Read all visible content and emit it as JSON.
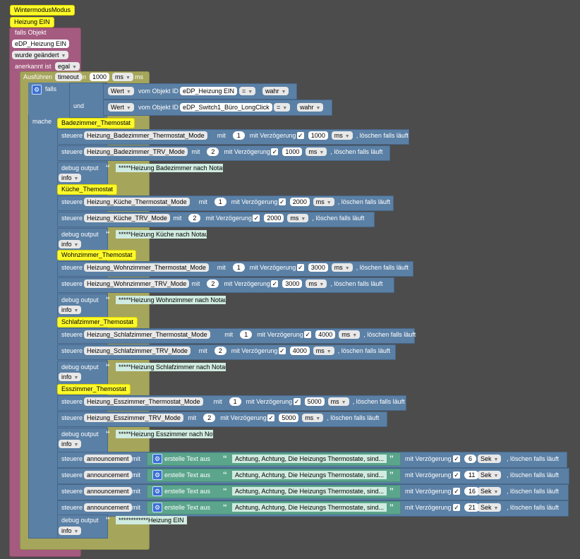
{
  "comments": {
    "title": "WintermodusModus",
    "subtitle": "Heizung EIN"
  },
  "trigger": {
    "falls_objekt": "falls Objekt",
    "object_id": "eDP_Heizung EIN",
    "wurde_label": "wurde geändert",
    "anerkannt_label": "anerkannt ist",
    "anerkannt_value": "egal"
  },
  "timeout": {
    "ausfuehren": "Ausführen",
    "var": "timeout",
    "in": "in",
    "value": "1000",
    "unit": "ms",
    "unit_suffix": "ms"
  },
  "if_block": {
    "falls": "falls",
    "und": "und",
    "mache": "mache",
    "cond1": {
      "wert": "Wert",
      "vom_objekt": "vom Objekt ID",
      "object": "eDP_Heizung EIN",
      "op": "=",
      "value": "wahr"
    },
    "cond2": {
      "wert": "Wert",
      "vom_objekt": "vom Objekt ID",
      "object": "eDP_Switch1_Büro_LongClick",
      "op": "=",
      "value": "wahr"
    }
  },
  "labels": {
    "steuere": "steuere",
    "mit": "mit",
    "mit_verzoegerung": "mit Verzögerung",
    "loeschen": ", löschen falls läuft",
    "debug_output": "debug output",
    "info": "info",
    "erstelle_text": "erstelle Text aus"
  },
  "groups": [
    {
      "comment": "Badezimmer_Themostat",
      "thermostat": "Heizung_Badezimmer_Thermostat_Mode",
      "trv": "Heizung_Badezimmer_TRV_Mode",
      "val1": "1",
      "val2": "2",
      "delay": "1000",
      "unit": "ms",
      "debug": "*****Heizung Badezimmer nach Notaus wieder ein"
    },
    {
      "comment": "Küche_Themostat",
      "thermostat": "Heizung_Küche_Thermostat_Mode",
      "trv": "Heizung_Küche_TRV_Mode",
      "val1": "1",
      "val2": "2",
      "delay": "2000",
      "unit": "ms",
      "debug": "*****Heizung Küche nach Notaus wieder ein"
    },
    {
      "comment": "Wohnzimmer_Themostat",
      "thermostat": "Heizung_Wohnzimmer_Thermostat_Mode",
      "trv": "Heizung_Wohnzimmer_TRV_Mode",
      "val1": "1",
      "val2": "2",
      "delay": "3000",
      "unit": "ms",
      "debug": "*****Heizung Wohnzimmer nach Notaus wieder ein"
    },
    {
      "comment": "Schlafzimmer_Themostat",
      "thermostat": "Heizung_Schlafzimmer_Thermostat_Mode",
      "trv": "Heizung_Schlafzimmer_TRV_Mode",
      "val1": "1",
      "val2": "2",
      "delay": "4000",
      "unit": "ms",
      "debug": "*****Heizung Schlafzimmer nach Notaus wieder ein"
    },
    {
      "comment": "Esszimmer_Themostat",
      "thermostat": "Heizung_Esszimmer_Thermostat_Mode",
      "trv": "Heizung_Esszimmer_TRV_Mode",
      "val1": "1",
      "val2": "2",
      "delay": "5000",
      "unit": "ms",
      "debug": "*****Heizung Esszimmer nach Notaus wieder ein"
    }
  ],
  "announcements": [
    {
      "target": "announcement",
      "text": "Achtung, Achtung, Die Heizungs Thermostate, sind...",
      "delay": "6",
      "unit": "Sek"
    },
    {
      "target": "announcement",
      "text": "Achtung, Achtung, Die Heizungs Thermostate, sind...",
      "delay": "11",
      "unit": "Sek"
    },
    {
      "target": "announcement",
      "text": "Achtung, Achtung, Die Heizungs Thermostate, sind...",
      "delay": "16",
      "unit": "Sek"
    },
    {
      "target": "announcement",
      "text": "Achtung, Achtung, Die Heizungs Thermostate, sind...",
      "delay": "21",
      "unit": "Sek"
    }
  ],
  "final_debug": {
    "text": "************Heizung EIN",
    "level": "info"
  },
  "colors": {
    "workspace": "#4c4c4c",
    "trigger": "#a55b80",
    "timeout": "#a5a55b",
    "logic": "#5b80a5",
    "text": "#5ba58c",
    "comment": "#fdf92a"
  }
}
